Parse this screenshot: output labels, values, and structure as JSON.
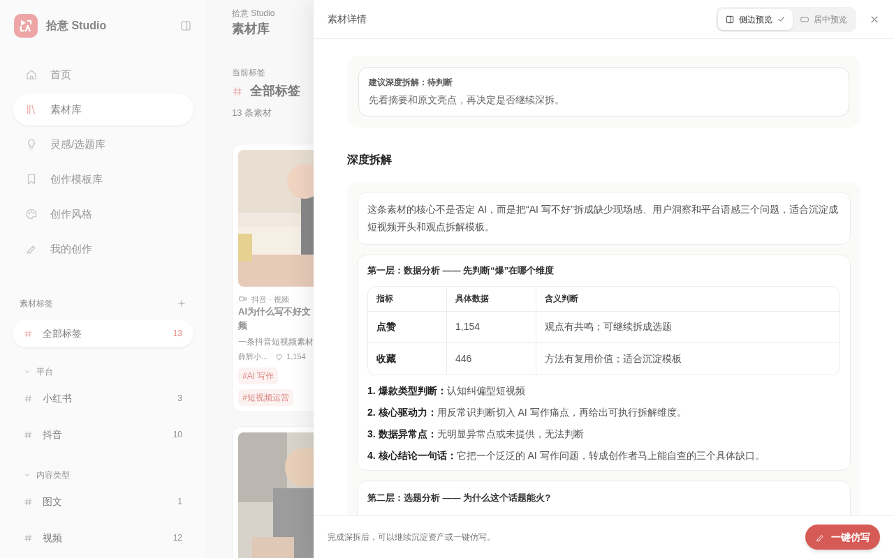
{
  "sidebar": {
    "brand": "拾意 Studio",
    "nav": [
      {
        "label": "首页",
        "selected": false
      },
      {
        "label": "素材库",
        "selected": true
      },
      {
        "label": "灵感/选题库",
        "selected": false
      },
      {
        "label": "创作模板库",
        "selected": false
      },
      {
        "label": "创作风格",
        "selected": false
      },
      {
        "label": "我的创作",
        "selected": false
      }
    ],
    "tags_title": "素材标签",
    "all_tag": {
      "label": "全部标签",
      "count": "13",
      "selected": true
    },
    "groups": [
      {
        "title": "平台",
        "expanded": true,
        "items": [
          {
            "label": "小红书",
            "count": "3",
            "selected": false
          },
          {
            "label": "抖音",
            "count": "10",
            "selected": false
          }
        ]
      },
      {
        "title": "内容类型",
        "expanded": true,
        "items": [
          {
            "label": "图文",
            "count": "1",
            "selected": false
          },
          {
            "label": "视频",
            "count": "12",
            "selected": false
          }
        ]
      }
    ]
  },
  "main": {
    "breadcrumb": "拾意 Studio",
    "title": "素材库",
    "current_label": "当前标签",
    "current_tag": "全部标签",
    "count": "13 条素材",
    "cards": [
      {
        "source": "抖音 · 视频",
        "title_lines": [
          "AI为什么写不好文",
          "频"
        ],
        "desc": "一条抖音短视频素材",
        "author": "薛辉小...",
        "likes": "1,154",
        "tags": [
          "#AI 写作",
          "#短视频运营"
        ]
      },
      {
        "kind": "picture"
      }
    ]
  },
  "panel": {
    "title": "素材详情",
    "modes": [
      {
        "label": "侧边预览",
        "selected": true
      },
      {
        "label": "居中预览",
        "selected": false
      }
    ],
    "suggest": {
      "title": "建议深度拆解：待判断",
      "text": "先看摘要和原文亮点，再决定是否继续深拆。"
    },
    "deep_heading": "深度拆解",
    "summary": "这条素材的核心不是否定 AI，而是把“AI 写不好”拆成缺少现场感、用户洞察和平台语感三个问题，适合沉淀成短视频开头和观点拆解模板。",
    "layer1": {
      "title": "第一层：数据分析 —— 先判断“爆”在哪个维度",
      "table": {
        "columns": [
          "指标",
          "具体数据",
          "含义判断"
        ],
        "rows": [
          [
            "点赞",
            "1,154",
            "观点有共鸣；可继续拆成选题"
          ],
          [
            "收藏",
            "446",
            "方法有复用价值；适合沉淀模板"
          ]
        ]
      },
      "points": [
        "**1. 爆款类型判断：**认知纠偏型短视频",
        "**2. 核心驱动力：**用反常识判断切入 AI 写作痛点，再给出可执行拆解维度。",
        "**3. 数据异常点：**无明显异常点或未提供，无法判断",
        "**4. 核心结论一句话：**它把一个泛泛的 AI 写作问题，转成创作者马上能自查的三个具体缺口。"
      ]
    },
    "layer2": {
      "title": "第二层：选题分析 —— 为什么这个话题能火?"
    },
    "footer_note": "完成深拆后，可以继续沉淀资产或一键仿写。",
    "action": "一键仿写"
  }
}
